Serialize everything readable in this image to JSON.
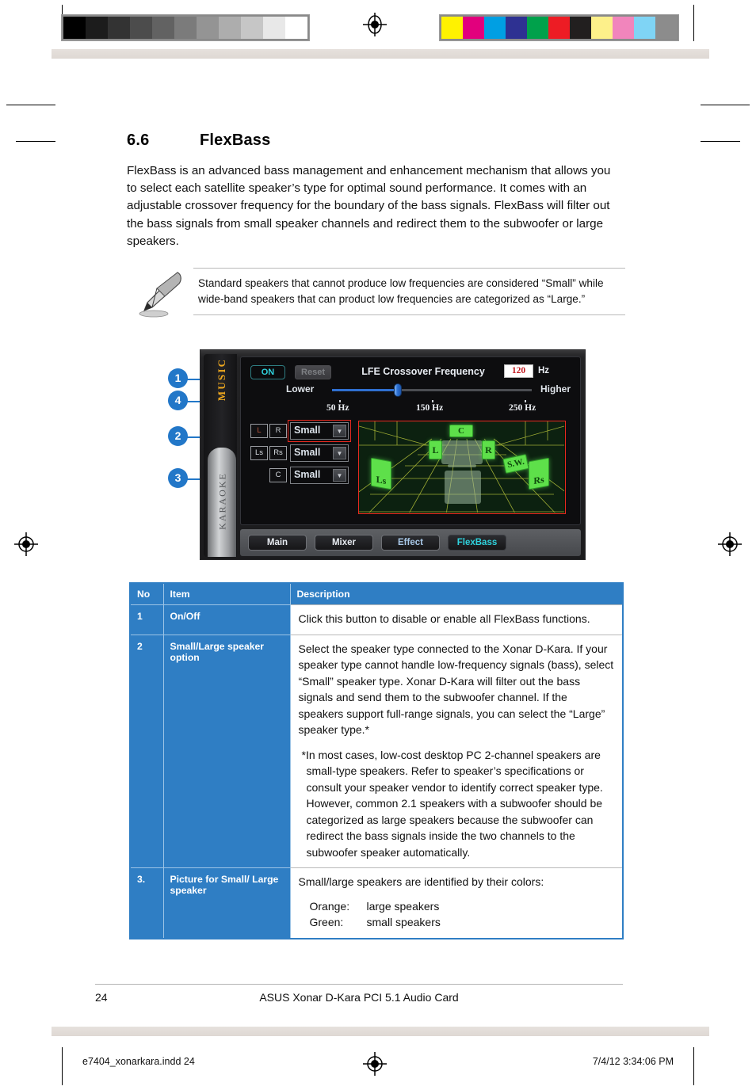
{
  "section": {
    "number": "6.6",
    "title": "FlexBass",
    "intro": "FlexBass is an advanced bass management and enhancement mechanism that allows you to select each satellite speaker’s type for optimal sound performance.  It comes with an adjustable crossover frequency for the boundary of the bass signals.  FlexBass will filter out the bass signals from small speaker channels and redirect them to the subwoofer or large speakers."
  },
  "note": {
    "icon": "pencil-icon",
    "text": "Standard speakers that cannot produce low frequencies are considered “Small” while wide-band speakers that can product low frequencies are categorized as “Large.”"
  },
  "app": {
    "rail": {
      "music": "MUSIC",
      "karaoke": "KARAOKE"
    },
    "on_button": "ON",
    "reset_button": "Reset",
    "lfe_title": "LFE Crossover Frequency",
    "lfe_value": "120",
    "lfe_unit": "Hz",
    "slider": {
      "lower_label": "Lower",
      "higher_label": "Higher",
      "ticks": [
        "50 Hz",
        "150 Hz",
        "250 Hz"
      ],
      "value_percent": 33
    },
    "speaker_rows": [
      {
        "ch_a": "L",
        "ch_b": "R",
        "value": "Small",
        "highlighted": true
      },
      {
        "ch_a": "Ls",
        "ch_b": "Rs",
        "value": "Small",
        "highlighted": false
      },
      {
        "ch_a": "",
        "ch_b": "C",
        "value": "Small",
        "highlighted": false
      }
    ],
    "viz_speakers": [
      "C",
      "L",
      "R",
      "Ls",
      "Rs",
      "S.W."
    ],
    "tabs": [
      {
        "label": "Main",
        "active": false
      },
      {
        "label": "Mixer",
        "active": false
      },
      {
        "label": "Effect",
        "active": false
      },
      {
        "label": "FlexBass",
        "active": true
      }
    ],
    "callouts": [
      "1",
      "4",
      "2",
      "3"
    ]
  },
  "table": {
    "headers": [
      "No",
      "Item",
      "Description"
    ],
    "rows": [
      {
        "no": "1",
        "item": "On/Off",
        "paragraphs": [
          "Click this button to disable or enable all FlexBass functions."
        ]
      },
      {
        "no": "2",
        "item": "Small/Large speaker option",
        "paragraphs": [
          "Select the speaker type connected to the Xonar D-Kara.  If your speaker type cannot handle low-frequency signals (bass), select “Small” speaker type.  Xonar D-Kara will filter out the bass signals and send them to the subwoofer channel.  If the speakers support full-range signals, you can select the “Large” speaker type.*",
          "*In most cases, low-cost desktop PC 2-channel speakers are small-type speakers.  Refer to speaker’s specifications or consult your speaker vendor to identify correct speaker type.  However, common 2.1 speakers with a subwoofer should be categorized as large speakers because the subwoofer can redirect the bass signals inside the two channels to the subwoofer speaker automatically."
        ]
      },
      {
        "no": "3.",
        "item": "Picture for Small/ Large speaker",
        "paragraphs": [
          "Small/large speakers are identified by their colors:"
        ],
        "color_key": [
          {
            "key": "Orange:",
            "value": "large speakers"
          },
          {
            "key": "Green:",
            "value": "small speakers"
          }
        ]
      }
    ]
  },
  "footer": {
    "page_number": "24",
    "document_title": "ASUS Xonar D-Kara PCI 5.1 Audio Card",
    "proof_file": "e7404_xonarkara.indd   24",
    "proof_timestamp": "7/4/12   3:34:06 PM"
  },
  "proof_bars": {
    "gray_swatches": [
      "#000000",
      "#1c1c1c",
      "#333333",
      "#4c4c4c",
      "#626262",
      "#7b7b7b",
      "#949494",
      "#adadad",
      "#c6c6c6",
      "#e8e8e8",
      "#ffffff"
    ],
    "color_swatches": [
      "#fff200",
      "#e2007d",
      "#009fe3",
      "#2e3192",
      "#00a14b",
      "#ed1c24",
      "#221f1f",
      "#fdf08a",
      "#f185bc",
      "#7fd4f5",
      "#8c8c8c"
    ]
  }
}
